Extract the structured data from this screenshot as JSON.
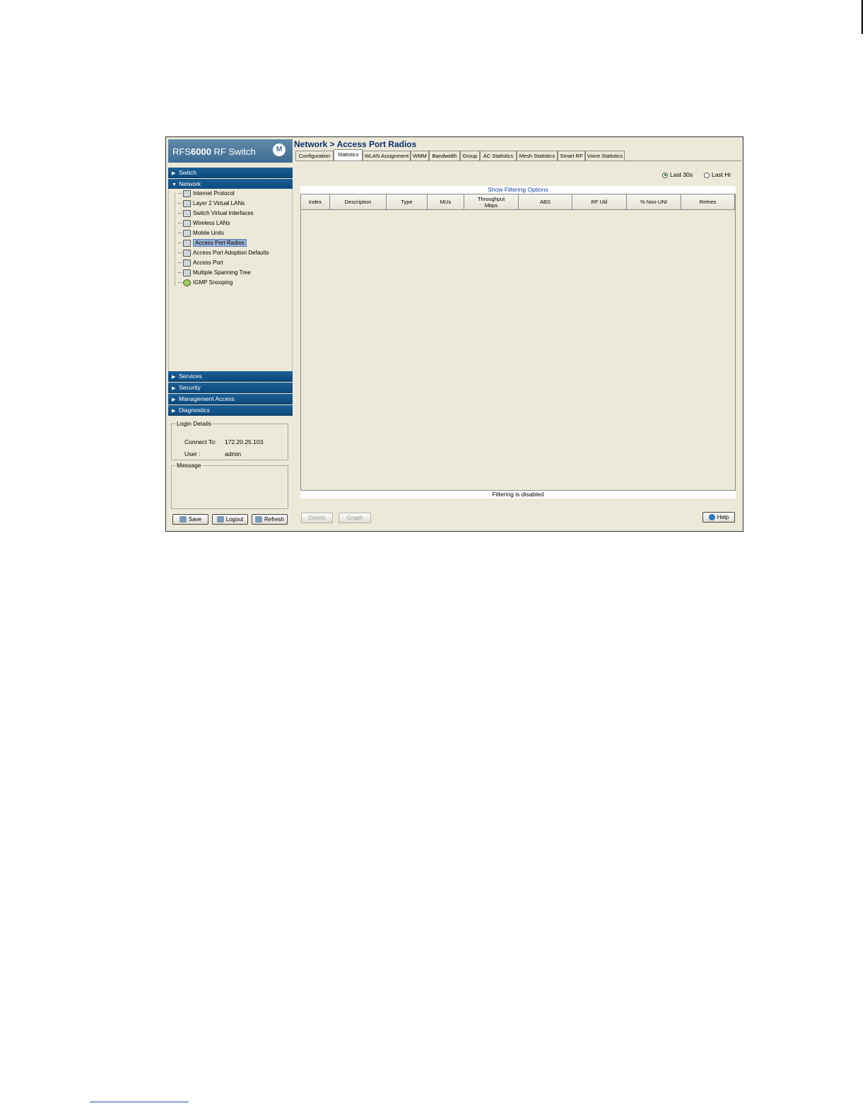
{
  "brand": {
    "prefix": "RFS",
    "model": "6000",
    "suffix": " RF Switch"
  },
  "nav": {
    "sections_top": [
      {
        "label": "Switch",
        "arrow": "▶"
      },
      {
        "label": "Network",
        "arrow": "▼"
      }
    ],
    "network_items": [
      "Internet Protocol",
      "Layer 2 Virtual LANs",
      "Switch Virtual Interfaces",
      "Wireless LANs",
      "Mobile Units",
      "Access Port Radios",
      "Access Port Adoption Defaults",
      "Access Port",
      "Multiple Spanning Tree",
      "IGMP Snooping"
    ],
    "sections_bottom": [
      {
        "label": "Services",
        "arrow": "▶"
      },
      {
        "label": "Security",
        "arrow": "▶"
      },
      {
        "label": "Management Access",
        "arrow": "▶"
      },
      {
        "label": "Diagnostics",
        "arrow": "▶"
      }
    ]
  },
  "login": {
    "title": "Login Details",
    "connect_label": "Connect To:",
    "connect_value": "172.20.25.103",
    "user_label": "User :",
    "user_value": "admin"
  },
  "message": {
    "title": "Message"
  },
  "left_buttons": {
    "save": "Save",
    "logout": "Logout",
    "refresh": "Refresh"
  },
  "page": {
    "title": "Network > Access Port Radios"
  },
  "tabs": [
    "Configuration",
    "Statistics",
    "WLAN Assignment",
    "WMM",
    "Bandwidth",
    "Group",
    "AC Statistics",
    "Mesh Statistics",
    "Smart RF",
    "Voice Statistics"
  ],
  "radios": {
    "last30": "Last 30s",
    "lasthr": "Last Hr",
    "selected": "Last 30s"
  },
  "table": {
    "filter_link": "Show Filtering Options",
    "columns": [
      "Index",
      "Description",
      "Type",
      "MUs",
      "Throughput Mbps",
      "ABS",
      "RF Util",
      "% Non-UNI",
      "Retries"
    ],
    "status": "Filtering is disabled"
  },
  "bottom_buttons": {
    "details": "Details",
    "graph": "Graph",
    "help": "Help"
  }
}
